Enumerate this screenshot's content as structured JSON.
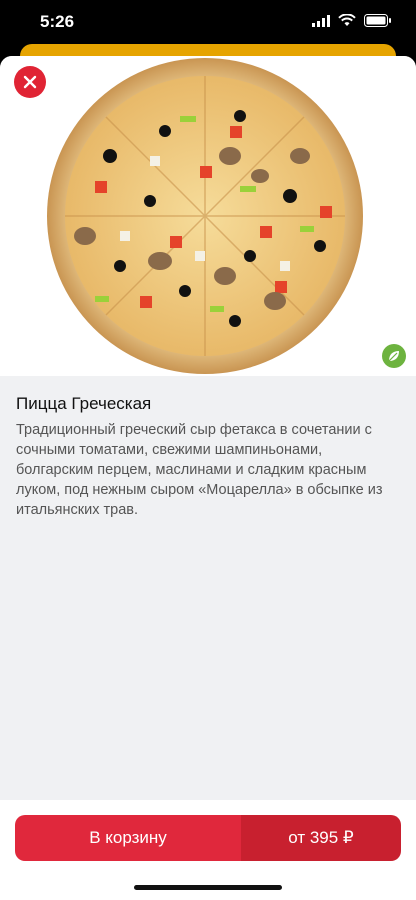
{
  "status": {
    "time": "5:26"
  },
  "product": {
    "title": "Пицца Греческая",
    "description": "Традиционный греческий сыр фетакса в сочетании с сочными томатами, свежими шампиньонами, болгарским перцем, маслинами и сладким красным луком, под нежным сыром «Моцарелла» в обсыпке из итальянских трав."
  },
  "cart": {
    "label": "В корзину",
    "price": "от 395 ₽"
  },
  "icons": [
    "close-icon",
    "leaf-icon",
    "wifi-icon",
    "battery-icon",
    "signal-icon"
  ],
  "colors": {
    "accent": "#e0283c",
    "veg": "#6db33f"
  }
}
